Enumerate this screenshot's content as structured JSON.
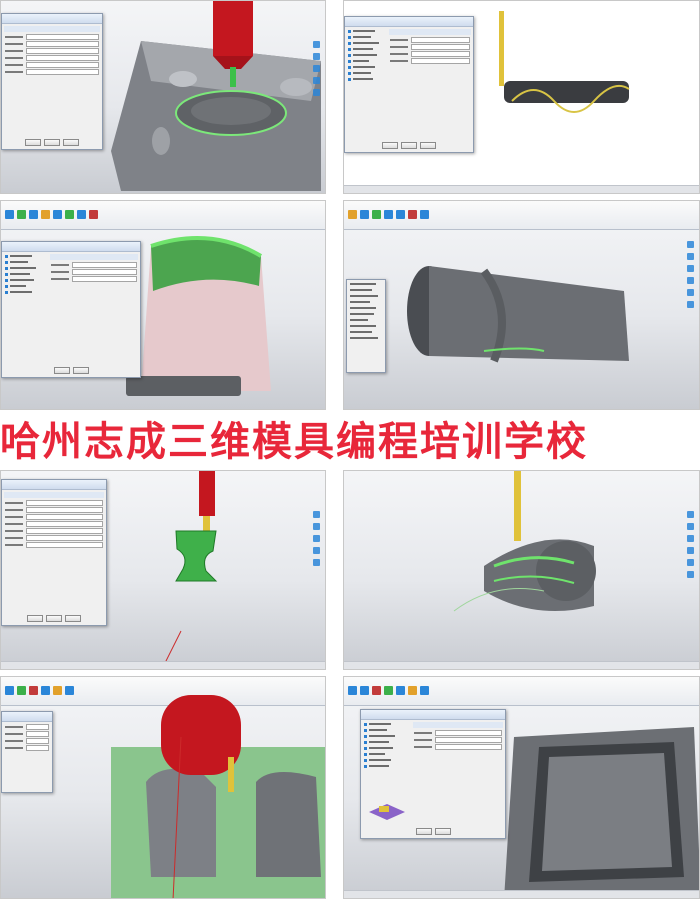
{
  "banner": {
    "text": "哈州志成三维模具编程培训学校"
  },
  "colors": {
    "toolpath": "#6fe36c",
    "spindle": "#c4171f",
    "part": "#8a8d93",
    "accent": "#2b86d8",
    "banner": "#e8273a"
  },
  "icons": [
    "ribbon-tool-icon",
    "view-cube-icon",
    "tree-folder-icon",
    "axis-triad-icon"
  ]
}
